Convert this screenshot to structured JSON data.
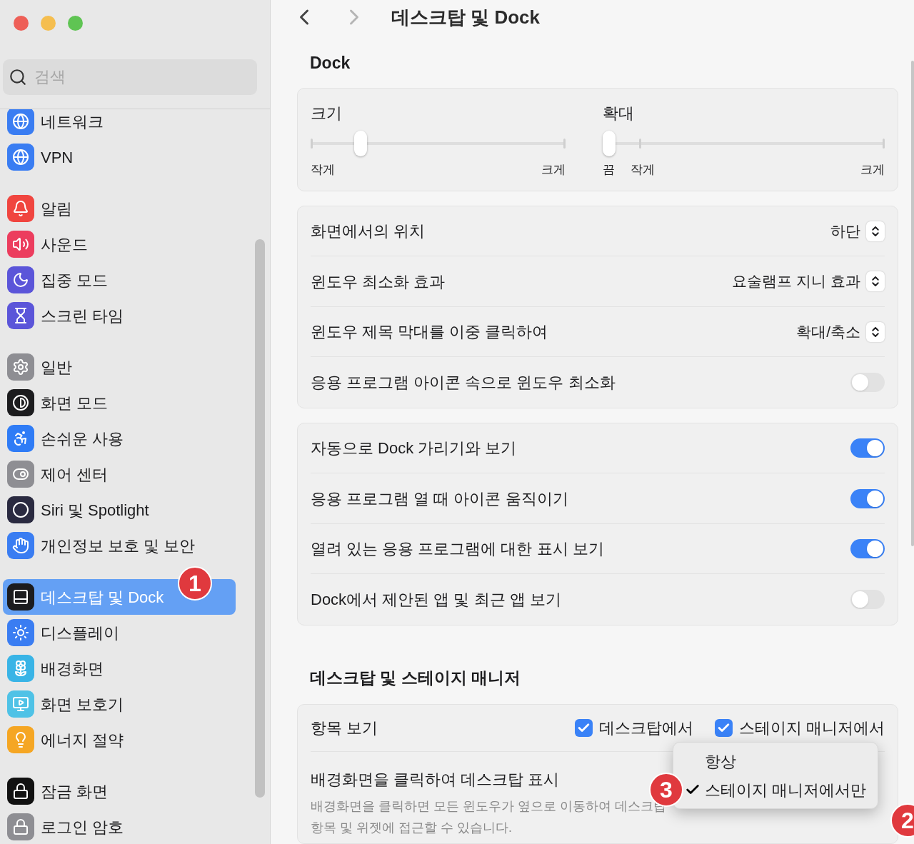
{
  "window": {
    "controls": [
      {
        "color": "#ee5f57"
      },
      {
        "color": "#f5be4f"
      },
      {
        "color": "#5fc453"
      }
    ]
  },
  "search": {
    "placeholder": "검색"
  },
  "sidebar": {
    "groups": [
      {
        "items": [
          {
            "label": "네트워크",
            "kind": "globe",
            "color": "#3a7df2",
            "selected": false
          },
          {
            "label": "VPN",
            "kind": "globe",
            "color": "#3a7df2",
            "selected": false
          }
        ]
      },
      {
        "items": [
          {
            "label": "알림",
            "kind": "bell",
            "color": "#f0453f",
            "selected": false
          },
          {
            "label": "사운드",
            "kind": "speaker",
            "color": "#ec3d5e",
            "selected": false
          },
          {
            "label": "집중 모드",
            "kind": "moon",
            "color": "#5b55d9",
            "selected": false
          },
          {
            "label": "스크린 타임",
            "kind": "hourglass",
            "color": "#5b55d9",
            "selected": false
          }
        ]
      },
      {
        "items": [
          {
            "label": "일반",
            "kind": "gear",
            "color": "#8e8e93",
            "selected": false
          },
          {
            "label": "화면 모드",
            "kind": "contrast",
            "color": "#1c1c1e",
            "selected": false
          },
          {
            "label": "손쉬운 사용",
            "kind": "accessibility",
            "color": "#2f7cf6",
            "selected": false
          },
          {
            "label": "제어 센터",
            "kind": "toggles",
            "color": "#8e8e93",
            "selected": false
          },
          {
            "label": "Siri 및 Spotlight",
            "kind": "orb",
            "color": "#2a2a40",
            "selected": false
          },
          {
            "label": "개인정보 보호 및 보안",
            "kind": "hand",
            "color": "#3a7df2",
            "selected": false
          }
        ]
      },
      {
        "items": [
          {
            "label": "데스크탑 및 Dock",
            "kind": "dock",
            "color": "#1c1c1e",
            "selected": true,
            "badge": "1"
          },
          {
            "label": "디스플레이",
            "kind": "sun",
            "color": "#3a7df2",
            "selected": false
          },
          {
            "label": "배경화면",
            "kind": "flower",
            "color": "#39b4e6",
            "selected": false
          },
          {
            "label": "화면 보호기",
            "kind": "screen",
            "color": "#4fc2e6",
            "selected": false
          },
          {
            "label": "에너지 절약",
            "kind": "bulb",
            "color": "#f5a623",
            "selected": false
          }
        ]
      },
      {
        "items": [
          {
            "label": "잠금 화면",
            "kind": "lock",
            "color": "#111111",
            "selected": false
          },
          {
            "label": "로그인 암호",
            "kind": "lock",
            "color": "#8e8e93",
            "selected": false
          }
        ]
      }
    ]
  },
  "header": {
    "title": "데스크탑 및 Dock"
  },
  "dock": {
    "heading": "Dock",
    "sliders": [
      {
        "label": "크기",
        "level": 0.18,
        "scale_labels": [
          "작게",
          "크게"
        ]
      },
      {
        "label": "확대",
        "level": 0,
        "scale_labels": [
          "끔",
          "작게",
          "크게"
        ]
      }
    ],
    "cards": [
      [
        {
          "kind": "popup",
          "label": "화면에서의 위치",
          "value": "하단"
        },
        {
          "kind": "popup",
          "label": "윈도우 최소화 효과",
          "value": "요술램프 지니 효과"
        },
        {
          "kind": "popup",
          "label": "윈도우 제목 막대를 이중 클릭하여",
          "value": "확대/축소"
        },
        {
          "kind": "toggle",
          "label": "응용 프로그램 아이콘 속으로 윈도우 최소화",
          "on": false
        }
      ],
      [
        {
          "kind": "toggle",
          "label": "자동으로 Dock 가리기와 보기",
          "on": true
        },
        {
          "kind": "toggle",
          "label": "응용 프로그램 열 때 아이콘 움직이기",
          "on": true
        },
        {
          "kind": "toggle",
          "label": "열려 있는 응용 프로그램에 대한 표시 보기",
          "on": true
        },
        {
          "kind": "toggle",
          "label": "Dock에서 제안된 앱 및 최근 앱 보기",
          "on": false
        }
      ]
    ]
  },
  "stage": {
    "heading": "데스크탑 및 스테이지 매니저",
    "rows": [
      {
        "kind": "checkboxes",
        "label": "항목 보기",
        "options": [
          {
            "label": "데스크탑에서",
            "checked": true
          },
          {
            "label": "스테이지 매니저에서",
            "checked": true
          }
        ]
      },
      {
        "kind": "menu",
        "label": "배경화면을 클릭하여 데스크탑 표시",
        "description": "배경화면을 클릭하면 모든 윈도우가 옆으로 이동하여 데스크탑 항목 및 위젯에 접근할 수 있습니다.",
        "badge": "2",
        "menu": [
          {
            "label": "항상",
            "selected": false
          },
          {
            "label": "스테이지 매니저에서만",
            "selected": true,
            "badge": "3"
          }
        ]
      }
    ]
  }
}
